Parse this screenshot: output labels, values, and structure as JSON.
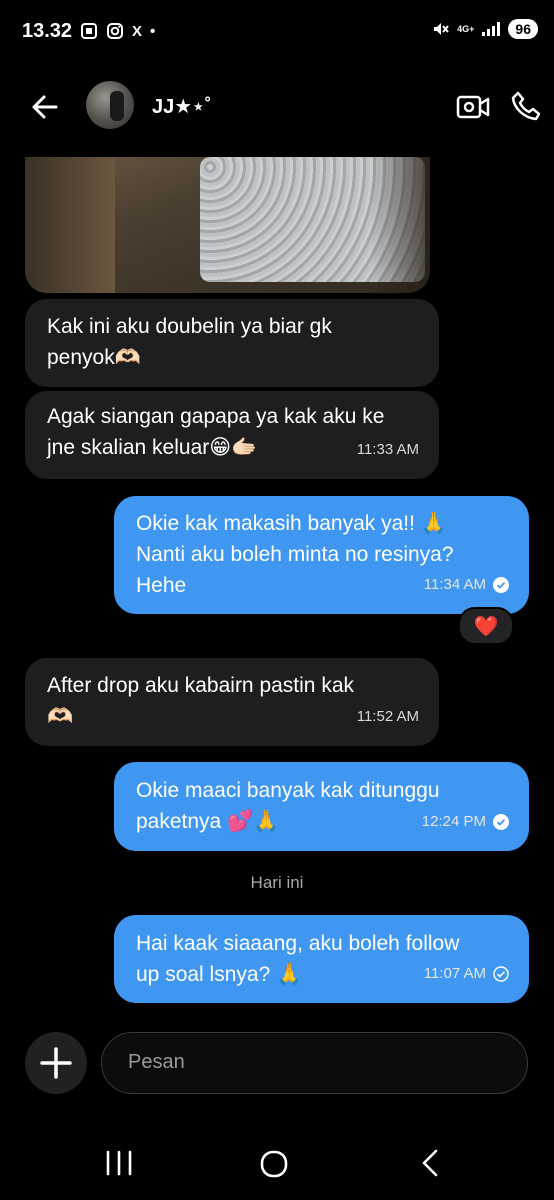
{
  "status_bar": {
    "time": "13.32",
    "left_icons": [
      "screenshot-icon",
      "instagram-icon",
      "x-icon",
      "dot-icon"
    ],
    "x_label": "X",
    "dot_label": "•",
    "network": "4G+",
    "battery": "96"
  },
  "header": {
    "contact_name": "JJ★⋆˚",
    "icons": [
      "back-arrow-icon",
      "video-camera-icon",
      "phone-icon"
    ]
  },
  "messages": [
    {
      "direction": "in",
      "text": "Kak ini aku doubelin ya biar gk\npenyok🫶🏻",
      "time": ""
    },
    {
      "direction": "in",
      "text": "Agak siangan gapapa ya kak aku ke\njne skalian keluar😁🫱🏻",
      "time": "11:33 AM"
    },
    {
      "direction": "out",
      "text": "Okie kak makasih banyak ya!! 🙏\nNanti aku boleh minta no resinya?\nHehe",
      "time": "11:34 AM",
      "status": "read"
    },
    {
      "direction": "in",
      "text": "After drop aku kabairn pastin kak\n🫶🏻",
      "time": "11:52 AM"
    },
    {
      "direction": "out",
      "text": "Okie maaci banyak kak ditunggu\npaketnya 💕🙏",
      "time": "12:24 PM",
      "status": "read"
    },
    {
      "direction": "out",
      "text": "Hai kaak siaaang, aku boleh follow\nup soal lsnya? 🙏",
      "time": "11:07 AM",
      "status": "sent"
    }
  ],
  "reaction": "❤️",
  "date_separator": "Hari ini",
  "composer": {
    "placeholder": "Pesan",
    "add_icon": "plus-icon"
  },
  "nav_bar": [
    "recent-apps-icon",
    "home-icon",
    "back-icon"
  ],
  "colors": {
    "background": "#000000",
    "incoming_bubble": "#1e1e20",
    "outgoing_bubble": "#3f97f1"
  }
}
